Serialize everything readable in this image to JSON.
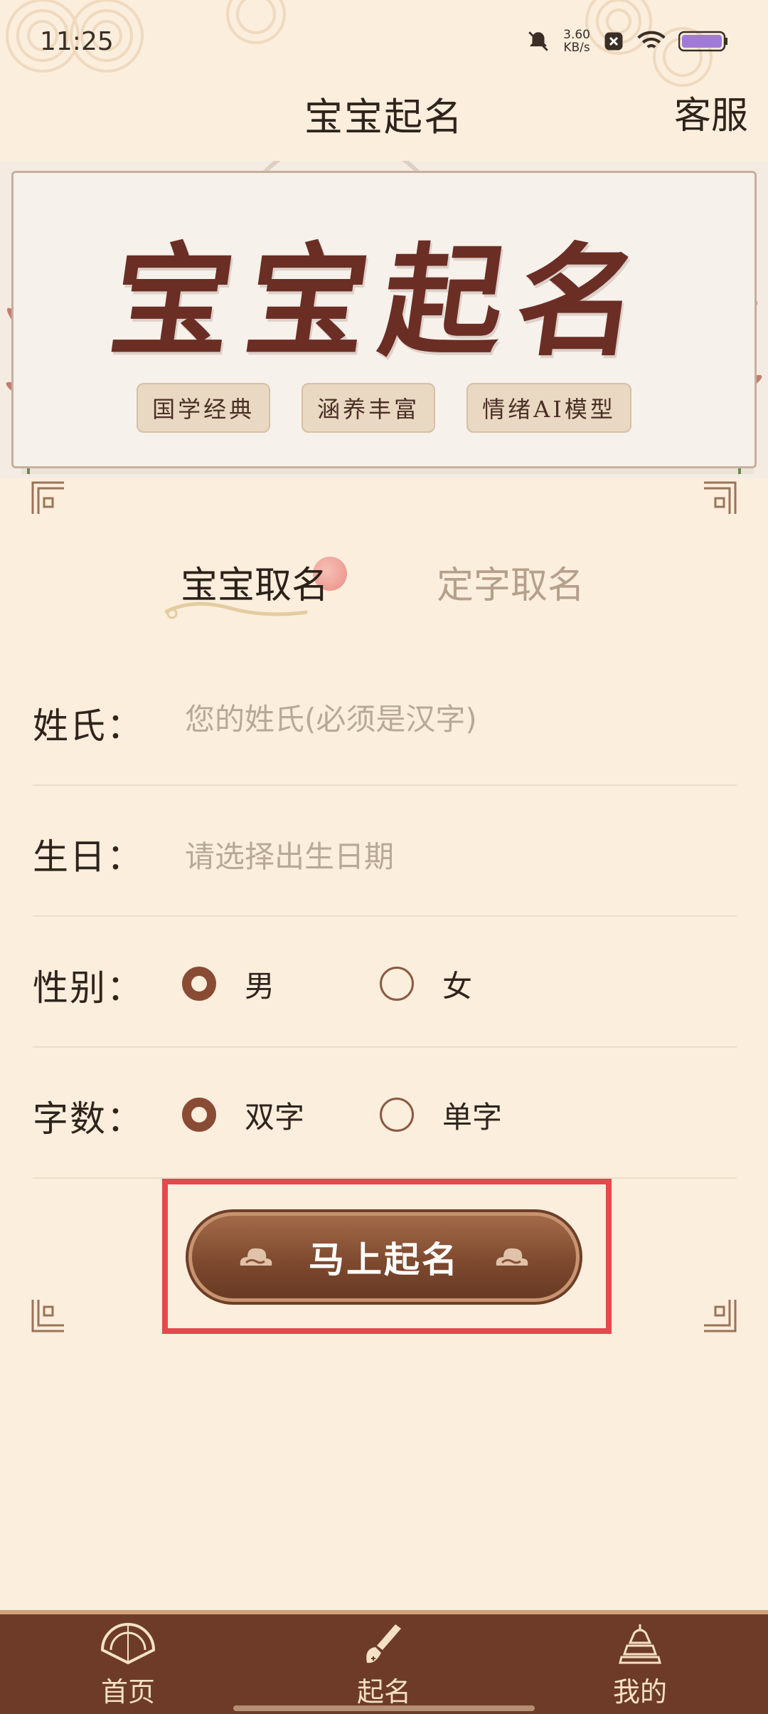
{
  "status_bar": {
    "time": "11:25",
    "net_speed_value": "3.60",
    "net_speed_unit": "KB/s",
    "icons": [
      "mute-bell-icon",
      "close-app-icon",
      "wifi-icon",
      "battery-icon"
    ]
  },
  "header": {
    "title": "宝宝起名",
    "service_label": "客服"
  },
  "banner": {
    "title": "宝宝起名",
    "tags": [
      "国学经典",
      "涵养丰富",
      "情绪AI模型"
    ]
  },
  "tabs": {
    "active": "宝宝取名",
    "inactive": "定字取名"
  },
  "form": {
    "surname_label": "姓氏：",
    "surname_placeholder": "您的姓氏(必须是汉字)",
    "birthday_label": "生日：",
    "birthday_placeholder": "请选择出生日期",
    "gender_label": "性别：",
    "gender_options": [
      "男",
      "女"
    ],
    "gender_selected": "男",
    "count_label": "字数：",
    "count_options": [
      "双字",
      "单字"
    ],
    "count_selected": "双字"
  },
  "submit": {
    "label": "马上起名"
  },
  "bottom_nav": {
    "items": [
      {
        "label": "首页",
        "icon": "fan-icon"
      },
      {
        "label": "起名",
        "icon": "brush-icon"
      },
      {
        "label": "我的",
        "icon": "pagoda-icon"
      }
    ]
  },
  "colors": {
    "background": "#fbeedd",
    "accent_brown": "#7e4a2f",
    "highlight_red": "#e5484d",
    "nav_bg": "#6d3b27"
  }
}
